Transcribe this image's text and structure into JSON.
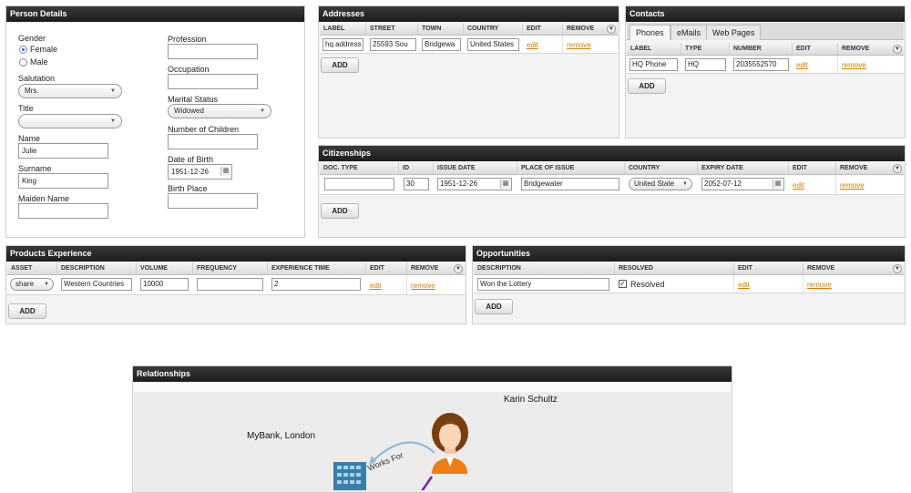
{
  "person": {
    "title": "Person Details",
    "gender_label": "Gender",
    "gender_options": [
      "Female",
      "Male"
    ],
    "salutation_label": "Salutation",
    "salutation_value": "Mrs.",
    "title_label": "Title",
    "title_value": "",
    "name_label": "Name",
    "name_value": "Julie",
    "surname_label": "Surname",
    "surname_value": "King",
    "maiden_label": "Maiden Name",
    "maiden_value": "",
    "profession_label": "Profession",
    "profession_value": "",
    "occupation_label": "Occupation",
    "occupation_value": "",
    "marital_label": "Marital Status",
    "marital_value": "Widowed",
    "children_label": "Number of Children",
    "children_value": "",
    "dob_label": "Date of Birth",
    "dob_value": "1951-12-26",
    "birthplace_label": "Birth Place",
    "birthplace_value": ""
  },
  "addresses": {
    "title": "Addresses",
    "columns": [
      "LABEL",
      "STREET",
      "TOWN",
      "COUNTRY",
      "EDIT",
      "REMOVE"
    ],
    "row": {
      "label": "hq address",
      "street": "25593 Sou",
      "town": "Bridgewa",
      "country": "United States",
      "edit": "edit",
      "remove": "remove"
    },
    "add": "ADD"
  },
  "contacts": {
    "title": "Contacts",
    "tabs": [
      "Phones",
      "eMails",
      "Web Pages"
    ],
    "columns": [
      "LABEL",
      "TYPE",
      "NUMBER",
      "EDIT",
      "REMOVE"
    ],
    "row": {
      "label": "HQ Phone",
      "type": "HQ",
      "number": "2035552570",
      "edit": "edit",
      "remove": "remove"
    },
    "add": "ADD"
  },
  "citizenships": {
    "title": "Citizenships",
    "columns": [
      "DOC. TYPE",
      "ID",
      "ISSUE DATE",
      "PLACE OF ISSUE",
      "COUNTRY",
      "EXPIRY DATE",
      "EDIT",
      "REMOVE"
    ],
    "row": {
      "doc_type": "",
      "id": "30",
      "issue_date": "1951-12-26",
      "place": "Bridgewater",
      "country": "United State",
      "expiry": "2052-07-12",
      "edit": "edit",
      "remove": "remove"
    },
    "add": "ADD"
  },
  "products": {
    "title": "Products Experience",
    "columns": [
      "ASSET",
      "DESCRIPTION",
      "VOLUME",
      "FREQUENCY",
      "EXPERIENCE TIME",
      "EDIT",
      "REMOVE"
    ],
    "row": {
      "asset": "share",
      "description": "Western Countries",
      "volume": "10000",
      "frequency": "",
      "experience_time": "2",
      "edit": "edit",
      "remove": "remove"
    },
    "add": "ADD"
  },
  "opportunities": {
    "title": "Opportunities",
    "columns": [
      "DESCRIPTION",
      "RESOLVED",
      "EDIT",
      "REMOVE"
    ],
    "row": {
      "description": "Won the Lottery",
      "resolved": "Resolved",
      "edit": "edit",
      "remove": "remove"
    },
    "add": "ADD"
  },
  "relationships": {
    "title": "Relationships",
    "person_name": "Karin Schultz",
    "org_name": "MyBank, London",
    "edge_label": "Works For"
  },
  "colors": {
    "header": "#1c1c1c",
    "link": "#d87c00",
    "person_hair": "#7a3e0e",
    "person_suit": "#f07d12",
    "building": "#3b7ea8",
    "edge_line": "#7a1fa0"
  },
  "icons": {
    "calendar": "calendar-icon",
    "dropdown": "chevron-down-icon",
    "column_menu": "column-menu-icon",
    "person": "person-icon",
    "building": "building-icon"
  }
}
